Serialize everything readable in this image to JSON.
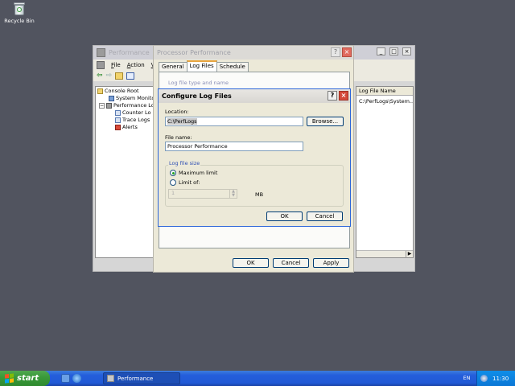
{
  "desktop": {
    "recycle_bin_label": "Recycle Bin"
  },
  "mmc": {
    "title": "Performance",
    "menu": [
      "File",
      "Action",
      "Vi"
    ],
    "tree": [
      "Console Root",
      "System Monitor",
      "Performance Lo",
      "Counter Lo",
      "Trace Logs",
      "Alerts"
    ],
    "right_column_header": "Log File Name",
    "right_cell": "C:\\PerfLogs\\System..."
  },
  "props_dialog": {
    "title": "Processor Performance",
    "tabs": [
      "General",
      "Log Files",
      "Schedule"
    ],
    "active_tab": "Log Files",
    "group_label": "Log file type and name",
    "ok_label": "OK",
    "cancel_label": "Cancel",
    "apply_label": "Apply"
  },
  "configure_dialog": {
    "title": "Configure Log Files",
    "location_label": "Location:",
    "location_value": "C:\\PerfLogs",
    "browse_label": "Browse...",
    "filename_label": "File name:",
    "filename_value": "Processor Performance",
    "log_size_legend": "Log file size",
    "max_limit_label": "Maximum limit",
    "limit_of_label": "Limit of:",
    "limit_value": "1",
    "unit_label": "MB",
    "ok_label": "OK",
    "cancel_label": "Cancel"
  },
  "taskbar": {
    "start_label": "start",
    "task_label": "Performance",
    "language": "EN",
    "clock": "11:30"
  }
}
